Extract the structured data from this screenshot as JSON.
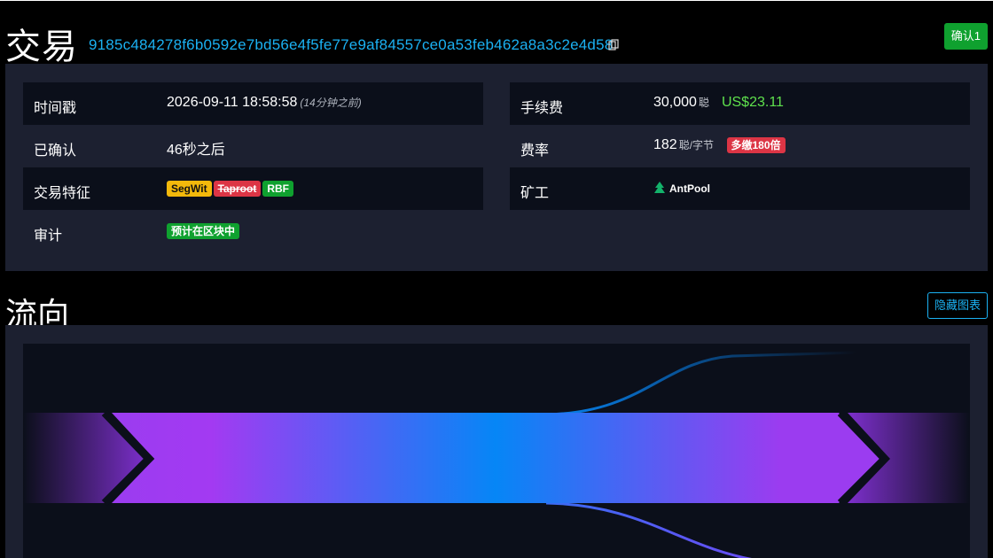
{
  "header": {
    "title": "交易",
    "txid": "9185c484278f6b0592e7bd56e4f5fe77e9af84557ce0a53feb462a8a3c2e4d58",
    "confirm_label": "确认1"
  },
  "details": {
    "timestamp": {
      "label": "时间戳",
      "value": "2026-09-11 18:58:58",
      "relative": "(14分钟之前)"
    },
    "confirmed": {
      "label": "已确认",
      "value": "46秒之后"
    },
    "features": {
      "label": "交易特征",
      "badges": {
        "segwit": "SegWit",
        "taproot": "Taproot",
        "rbf": "RBF"
      }
    },
    "audit": {
      "label": "审计",
      "badge": "预计在区块中"
    },
    "fee": {
      "label": "手续费",
      "value": "30,000",
      "unit": "聪",
      "usd": "US$23.11"
    },
    "fee_rate": {
      "label": "费率",
      "value": "182",
      "unit": "聪/字节",
      "badge": "多缴180倍"
    },
    "miner": {
      "label": "矿工",
      "pool": "AntPool"
    }
  },
  "flow": {
    "title": "流向",
    "hide_button": "隐藏图表"
  },
  "colors": {
    "accent": "#1bb1f2",
    "success": "#0fa12f",
    "warning": "#f3b90b",
    "danger": "#dc3545",
    "usd": "#5fe14d",
    "panel": "#1c2030",
    "panel_dark": "#0b0f1a"
  },
  "icons": {
    "copy": "copy-icon",
    "pool": "antpool-icon"
  }
}
